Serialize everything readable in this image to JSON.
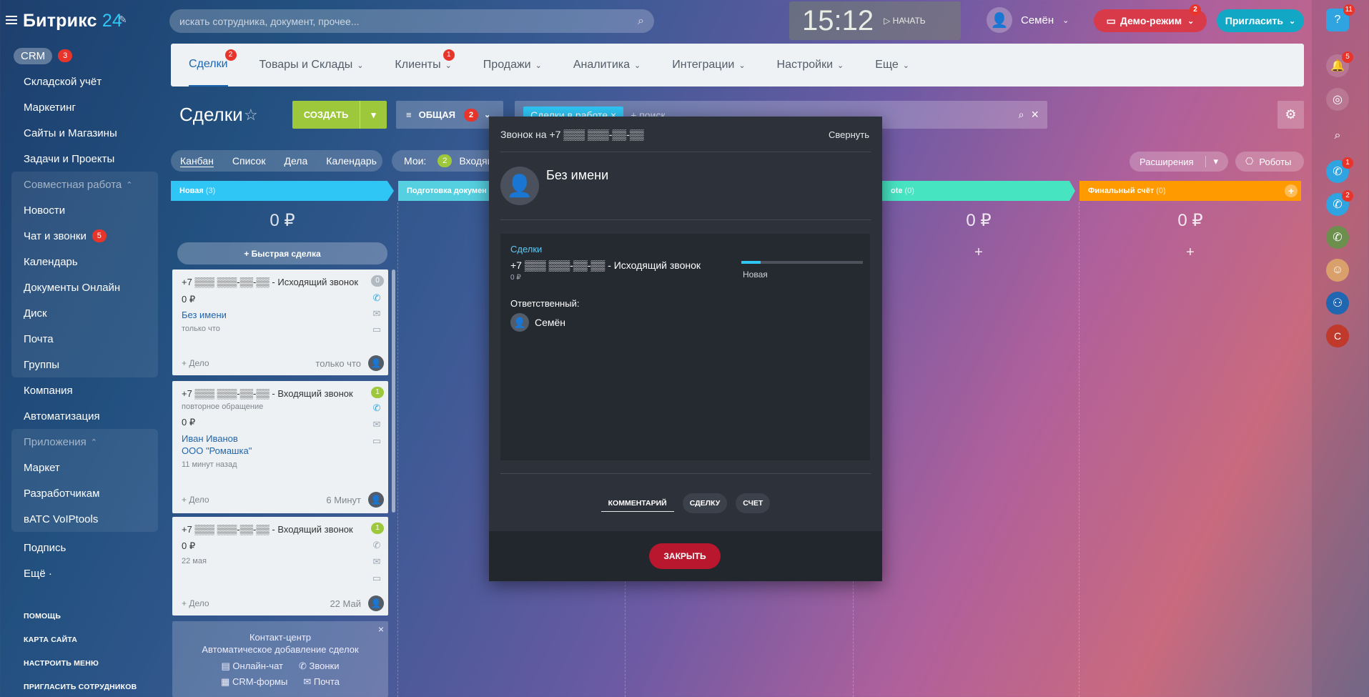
{
  "header": {
    "logo_brand": "Битрикс",
    "logo_num": "24",
    "search_placeholder": "искать сотрудника, документ, прочее...",
    "clock_time": "15:12",
    "clock_start": "НАЧАТЬ",
    "user_name": "Семён",
    "demo_label": "Демо-режим",
    "demo_badge": "2",
    "invite_label": "Пригласить"
  },
  "leftmenu": {
    "crm": "CRM",
    "crm_count": "3",
    "items": [
      "Складской учёт",
      "Маркетинг",
      "Сайты и Магазины",
      "Задачи и Проекты"
    ],
    "collab_group": "Совместная работа",
    "collab_items": [
      "Новости",
      "Чат и звонки",
      "Календарь",
      "Документы Онлайн",
      "Диск",
      "Почта",
      "Группы"
    ],
    "chat_count": "5",
    "company": "Компания",
    "automation": "Автоматизация",
    "apps_group": "Приложения",
    "apps_items": [
      "Маркет",
      "Разработчикам",
      "вАТС VoIPtools"
    ],
    "subscription": "Подпись",
    "more": "Ещё ·",
    "bottom": [
      "Помощь",
      "Карта сайта",
      "Настроить меню",
      "Пригласить сотрудников"
    ]
  },
  "topnav": {
    "items": [
      {
        "label": "Сделки",
        "badge": "2"
      },
      {
        "label": "Товары и Склады"
      },
      {
        "label": "Клиенты",
        "badge": "1"
      },
      {
        "label": "Продажи"
      },
      {
        "label": "Аналитика"
      },
      {
        "label": "Интеграции"
      },
      {
        "label": "Настройки"
      },
      {
        "label": "Еще"
      }
    ]
  },
  "toolbar": {
    "title": "Сделки",
    "create": "СОЗДАТЬ",
    "filter": "ОБЩАЯ",
    "filter_badge": "2",
    "filter_tag": "Сделки в работе",
    "filter_placeholder": "+ поиск"
  },
  "views": {
    "tabs": [
      "Канбан",
      "Список",
      "Дела",
      "Календарь"
    ],
    "mine_label": "Мои:",
    "mine_count": "2",
    "mine_text": "Входящ",
    "extensions": "Расширения",
    "robots": "Роботы"
  },
  "kanban": {
    "stages": [
      {
        "name": "Новая",
        "count": "(3)",
        "sum": "0 ₽",
        "color": "#2fc6f6"
      },
      {
        "name": "Подготовка докумен",
        "count": "",
        "sum": "",
        "color": "#55d0e0"
      },
      {
        "name": "ote",
        "count": "(0)",
        "sum": "0 ₽",
        "color": "#47e4c2"
      },
      {
        "name": "Финальный счёт",
        "count": "(0)",
        "sum": "0 ₽",
        "color": "#ff9a00"
      }
    ],
    "quick_deal": "+ Быстрая сделка",
    "cards": [
      {
        "title": "+7 ▒▒▒ ▒▒▒-▒▒-▒▒ - Исходящий звонок",
        "badge": "0",
        "sum": "0 ₽",
        "line1": "Без имени",
        "line2": "",
        "time": "только что",
        "delo": "+ Дело",
        "when": "только что",
        "note": ""
      },
      {
        "title": "+7 ▒▒▒ ▒▒▒-▒▒-▒▒ - Входящий звонок",
        "badge": "1",
        "note": "повторное обращение",
        "sum": "0 ₽",
        "line1": "Иван Иванов",
        "line2": "ООО \"Ромашка\"",
        "time": "11 минут назад",
        "delo": "+ Дело",
        "when": "6 Минут"
      },
      {
        "title": "+7 ▒▒▒ ▒▒▒-▒▒-▒▒ - Входящий звонок",
        "badge": "1",
        "sum": "0 ₽",
        "time": "22 мая",
        "delo": "+ Дело",
        "when": "22 Май",
        "line1": "",
        "line2": "",
        "note": ""
      }
    ],
    "contact_center": {
      "title": "Контакт-центр",
      "subtitle": "Автоматическое добавление сделок",
      "links": [
        "Онлайн-чат",
        "Звонки",
        "CRM-формы",
        "Почта"
      ]
    }
  },
  "call_modal": {
    "header": "Звонок на +7 ▒▒▒ ▒▒▒-▒▒-▒▒",
    "collapse": "Свернуть",
    "contact": "Без имени",
    "deals_label": "Сделки",
    "deal_title": "+7 ▒▒▒ ▒▒▒-▒▒-▒▒ - Исходящий звонок",
    "deal_sum": "0 ₽",
    "deal_stage": "Новая",
    "deal_progress": 0.16,
    "responsible_label": "Ответственный:",
    "responsible": "Семён",
    "tabs": [
      "КОММЕНТАРИЙ",
      "СДЕЛКУ",
      "СЧЕТ"
    ],
    "close": "ЗАКРЫТЬ"
  },
  "rightbar": {
    "help_badge": "11",
    "notif_badge": "5",
    "calls": [
      {
        "badge": "1"
      },
      {
        "badge": "2"
      }
    ],
    "user_letter": "С"
  },
  "colors": {
    "accent": "#2fc6f6",
    "create": "#9dc83b",
    "danger": "#e8352c",
    "close": "#b8172e"
  }
}
